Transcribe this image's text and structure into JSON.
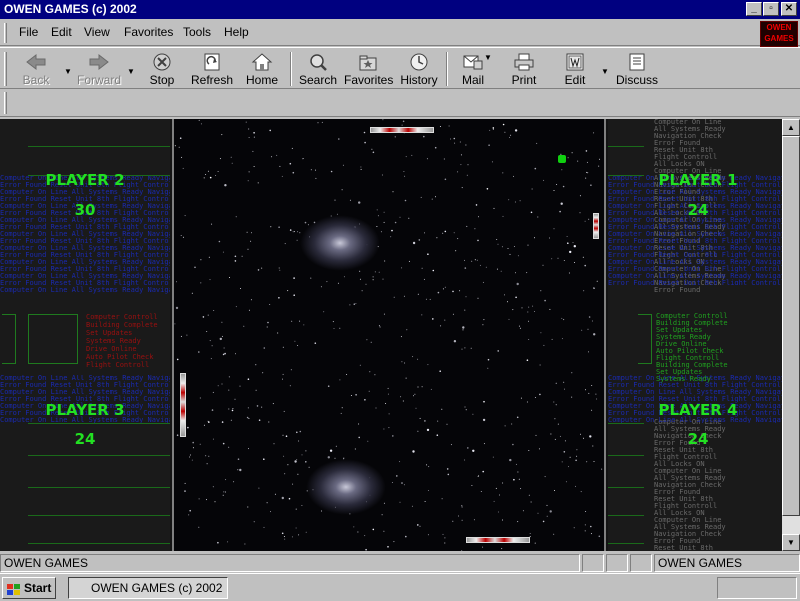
{
  "window": {
    "title": "OWEN GAMES (c) 2002"
  },
  "menu": {
    "items": [
      "File",
      "Edit",
      "View",
      "Favorites",
      "Tools",
      "Help"
    ],
    "underline": [
      "F",
      "E",
      "V",
      "a",
      "T",
      "H"
    ]
  },
  "brand": {
    "text": "OWEN GAMES"
  },
  "toolbar": {
    "back": "Back",
    "forward": "Forward",
    "stop": "Stop",
    "refresh": "Refresh",
    "home": "Home",
    "search": "Search",
    "favorites": "Favorites",
    "history": "History",
    "mail": "Mail",
    "print": "Print",
    "edit": "Edit",
    "discuss": "Discuss"
  },
  "game": {
    "players": [
      {
        "name": "PLAYER 2",
        "score": "30"
      },
      {
        "name": "PLAYER 1",
        "score": "24"
      },
      {
        "name": "PLAYER 3",
        "score": "24"
      },
      {
        "name": "PLAYER 4",
        "score": "24"
      }
    ]
  },
  "status": {
    "left": "OWEN GAMES",
    "right": "OWEN GAMES"
  },
  "taskbar": {
    "start": "Start",
    "task": "OWEN GAMES (c) 2002"
  }
}
